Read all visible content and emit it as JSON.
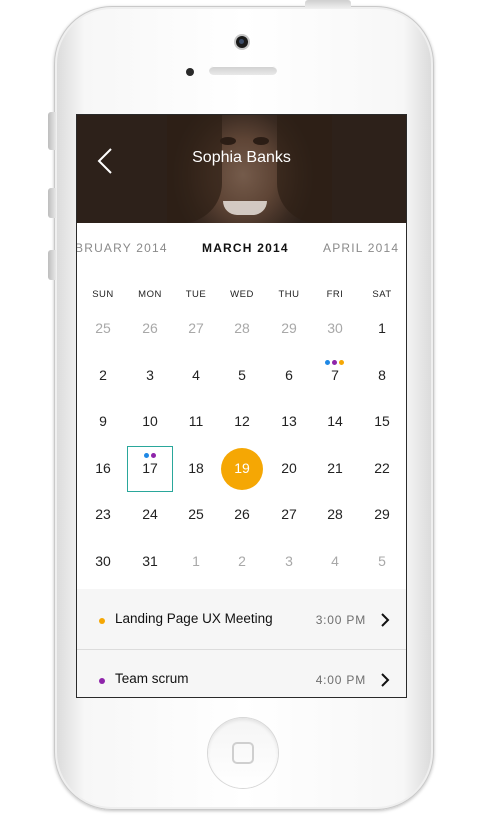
{
  "header": {
    "title": "Sophia Banks"
  },
  "months": {
    "prev": "BRUARY 2014",
    "current": "MARCH 2014",
    "next": "APRIL 2014"
  },
  "weekdays": [
    "SUN",
    "MON",
    "TUE",
    "WED",
    "THU",
    "FRI",
    "SAT"
  ],
  "weeks": [
    [
      "25",
      "26",
      "27",
      "28",
      "29",
      "30",
      "1"
    ],
    [
      "2",
      "3",
      "4",
      "5",
      "6",
      "7",
      "8"
    ],
    [
      "9",
      "10",
      "11",
      "12",
      "13",
      "14",
      "15"
    ],
    [
      "16",
      "17",
      "18",
      "19",
      "20",
      "21",
      "22"
    ],
    [
      "23",
      "24",
      "25",
      "26",
      "27",
      "28",
      "29"
    ],
    [
      "30",
      "31",
      "1",
      "2",
      "3",
      "4",
      "5"
    ]
  ],
  "colors": {
    "accent_today": "#f5a704",
    "selected_outline": "#2aa79b",
    "event_orange": "#f5a704",
    "event_purple": "#8e24aa",
    "event_teal": "#1e88e5"
  },
  "events": [
    {
      "title": "Landing Page UX Meeting",
      "time": "3:00 PM",
      "color": "#f5a704"
    },
    {
      "title": "Team scrum",
      "time": "4:00 PM",
      "color": "#8e24aa"
    }
  ]
}
